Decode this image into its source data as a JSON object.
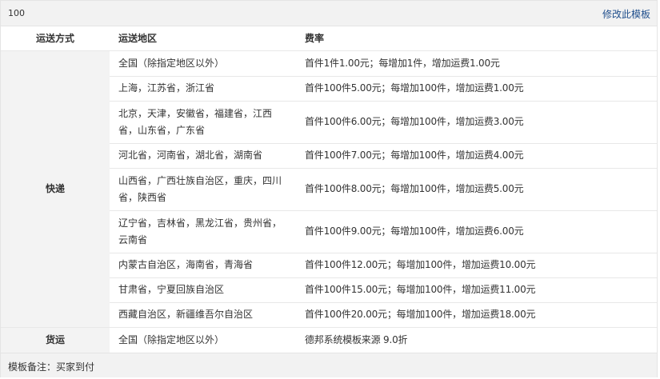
{
  "template": {
    "name": "100",
    "edit_label": "修改此模板"
  },
  "table": {
    "headers": {
      "method": "运送方式",
      "region": "运送地区",
      "fee": "费率"
    },
    "groups": [
      {
        "method": "快递",
        "rows": [
          {
            "region": "全国（除指定地区以外）",
            "fee": "首件1件1.00元；每增加1件，增加运费1.00元"
          },
          {
            "region": "上海，江苏省，浙江省",
            "fee": "首件100件5.00元；每增加100件，增加运费1.00元"
          },
          {
            "region": "北京，天津，安徽省，福建省，江西省，山东省，广东省",
            "fee": "首件100件6.00元；每增加100件，增加运费3.00元"
          },
          {
            "region": "河北省，河南省，湖北省，湖南省",
            "fee": "首件100件7.00元；每增加100件，增加运费4.00元"
          },
          {
            "region": "山西省，广西壮族自治区，重庆，四川省，陕西省",
            "fee": "首件100件8.00元；每增加100件，增加运费5.00元"
          },
          {
            "region": "辽宁省，吉林省，黑龙江省，贵州省，云南省",
            "fee": "首件100件9.00元；每增加100件，增加运费6.00元"
          },
          {
            "region": "内蒙古自治区，海南省，青海省",
            "fee": "首件100件12.00元；每增加100件，增加运费10.00元"
          },
          {
            "region": "甘肃省，宁夏回族自治区",
            "fee": "首件100件15.00元；每增加100件，增加运费11.00元"
          },
          {
            "region": "西藏自治区，新疆维吾尔自治区",
            "fee": "首件100件20.00元；每增加100件，增加运费18.00元"
          }
        ]
      },
      {
        "method": "货运",
        "rows": [
          {
            "region": "全国（除指定地区以外）",
            "fee": "德邦系统模板来源 9.0折"
          }
        ]
      }
    ]
  },
  "note": "模板备注：买家到付"
}
